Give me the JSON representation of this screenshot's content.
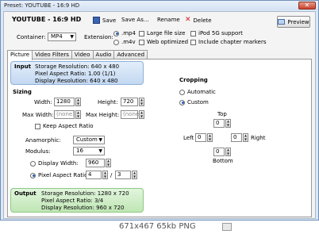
{
  "window": {
    "title": "Preset: YOUTUBE - 16:9 HD",
    "close_glyph": "✕"
  },
  "toolbar": {
    "preset_name": "YOUTUBE - 16:9 HD",
    "save_label": "Save",
    "save_as_label": "Save As...",
    "rename_label": "Rename",
    "delete_label": "Delete",
    "preview_label": "Preview"
  },
  "container": {
    "label": "Container:",
    "value": "MP4",
    "extension_label": "Extension:",
    "ext_mp4": ".mp4",
    "ext_m4v": ".m4v",
    "large_file_size": "Large file size",
    "web_optimized": "Web optimized",
    "ipod_5g": "iPod 5G support",
    "chapter_markers": "Include chapter markers"
  },
  "tabs": [
    "Picture",
    "Video Filters",
    "Video",
    "Audio",
    "Advanced"
  ],
  "input": {
    "title": "Input",
    "storage": "Storage Resolution:  640 x 480",
    "pixel_aspect": "Pixel Aspect Ratio:  1.00 (1/1)",
    "display": "Display Resolution:  640 x 480"
  },
  "sizing": {
    "title": "Sizing",
    "width_label": "Width:",
    "width_value": "1280",
    "height_label": "Height:",
    "height_value": "720",
    "max_width_label": "Max Width:",
    "max_width_value": "(none)",
    "max_height_label": "Max Height:",
    "max_height_value": "(none)",
    "keep_aspect": "Keep Aspect Ratio",
    "anamorphic_label": "Anamorphic:",
    "anamorphic_value": "Custom",
    "modulus_label": "Modulus:",
    "modulus_value": "16",
    "display_width_label": "Display Width:",
    "display_width_value": "960",
    "par_label": "Pixel Aspect Ratio:",
    "par_num": "4",
    "par_sep": "/",
    "par_den": "3"
  },
  "cropping": {
    "title": "Cropping",
    "automatic": "Automatic",
    "custom": "Custom",
    "top_label": "Top",
    "top_value": "0",
    "left_label": "Left",
    "left_value": "0",
    "right_label": "Right",
    "right_value": "0",
    "bottom_label": "Bottom",
    "bottom_value": "0"
  },
  "output": {
    "title": "Output",
    "storage": "Storage Resolution:  1280 x 720",
    "pixel_aspect": "Pixel Aspect Ratio:  3/4",
    "display": "Display Resolution:  960 x 720"
  },
  "status_bar": {
    "text": "671x467  65kb  PNG"
  }
}
